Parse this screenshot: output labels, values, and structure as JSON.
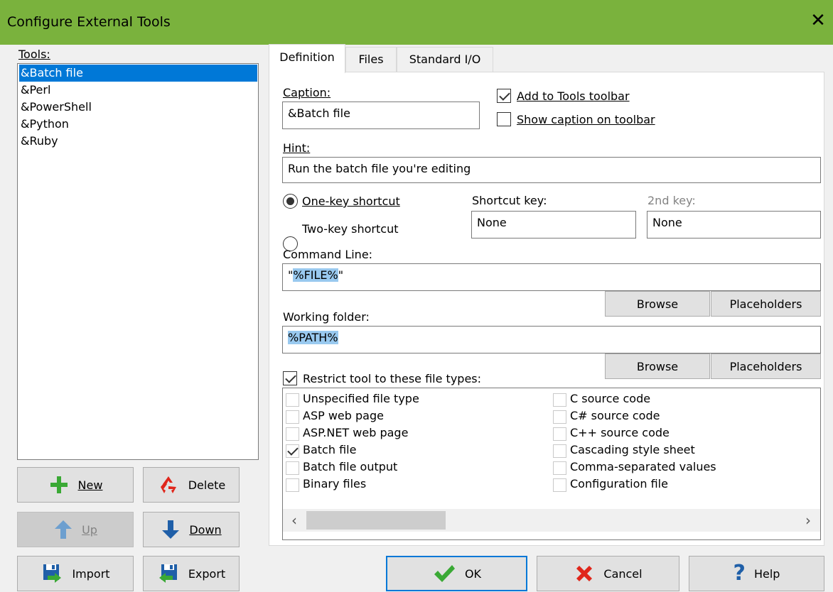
{
  "window": {
    "title": "Configure External Tools",
    "close_glyph": "✕"
  },
  "tools_panel": {
    "label": "Tools:",
    "items": [
      "&Batch file",
      "&Perl",
      "&PowerShell",
      "&Python",
      "&Ruby"
    ],
    "selected_index": 0,
    "buttons": {
      "new": "New",
      "delete": "Delete",
      "up": "Up",
      "down": "Down",
      "import": "Import",
      "export": "Export"
    }
  },
  "tabs": [
    "Definition",
    "Files",
    "Standard I/O"
  ],
  "active_tab": 0,
  "definition": {
    "caption_label": "Caption:",
    "caption_value": "&Batch file",
    "add_to_toolbar_label": "Add to Tools toolbar",
    "add_to_toolbar_checked": true,
    "show_caption_label": "Show caption on toolbar",
    "show_caption_checked": false,
    "hint_label": "Hint:",
    "hint_value": "Run the batch file you're editing",
    "one_key_label": "One-key shortcut",
    "two_key_label": "Two-key shortcut",
    "shortcut_mode": "one-key",
    "shortcut_key_label": "Shortcut key:",
    "shortcut_key_value": "None",
    "second_key_label": "2nd key:",
    "second_key_value": "None",
    "command_line_label": "Command Line:",
    "command_line_prefix": "\"",
    "command_line_selected": "%FILE%",
    "command_line_suffix": "\"",
    "working_folder_label": "Working folder:",
    "working_folder_value": "%PATH%",
    "browse_label": "Browse",
    "placeholders_label": "Placeholders",
    "restrict_label": "Restrict tool to these file types:",
    "restrict_checked": true,
    "file_types_left": [
      {
        "label": "Unspecified file type",
        "checked": false
      },
      {
        "label": "ASP web page",
        "checked": false
      },
      {
        "label": "ASP.NET web page",
        "checked": false
      },
      {
        "label": "Batch file",
        "checked": true
      },
      {
        "label": "Batch file output",
        "checked": false
      },
      {
        "label": "Binary files",
        "checked": false
      }
    ],
    "file_types_right": [
      {
        "label": "C source code",
        "checked": false
      },
      {
        "label": "C# source code",
        "checked": false
      },
      {
        "label": "C++ source code",
        "checked": false
      },
      {
        "label": "Cascading style sheet",
        "checked": false
      },
      {
        "label": "Comma-separated values",
        "checked": false
      },
      {
        "label": "Configuration file",
        "checked": false
      }
    ],
    "scroll_left_glyph": "‹",
    "scroll_right_glyph": "›"
  },
  "footer": {
    "ok": "OK",
    "cancel": "Cancel",
    "help": "Help"
  },
  "colors": {
    "titlebar": "#7ab23d",
    "selection": "#0078d7",
    "text_highlight": "#99c9ef",
    "ok_green": "#3aa935",
    "cancel_red": "#e0261b",
    "help_blue": "#1f5fa8"
  }
}
